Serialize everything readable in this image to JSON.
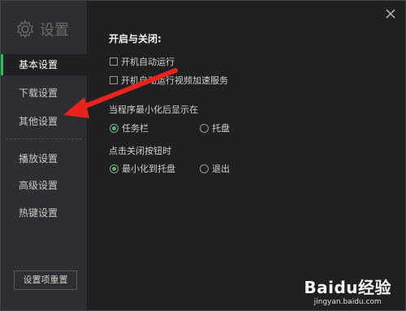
{
  "app": {
    "title": "设置"
  },
  "sidebar": {
    "items": [
      {
        "label": "基本设置",
        "active": true
      },
      {
        "label": "下载设置",
        "active": false
      },
      {
        "label": "其他设置",
        "active": false
      },
      {
        "label": "播放设置",
        "active": false
      },
      {
        "label": "高级设置",
        "active": false
      },
      {
        "label": "热键设置",
        "active": false
      }
    ],
    "reset_label": "设置项重置"
  },
  "main": {
    "section_title": "开启与关闭:",
    "options": [
      {
        "label": "开机自动运行",
        "checked": false
      },
      {
        "label": "开机自动运行视频加速服务",
        "checked": false
      }
    ],
    "minimize_group": {
      "label": "当程序最小化后显示在",
      "options": [
        {
          "label": "任务栏",
          "checked": true
        },
        {
          "label": "托盘",
          "checked": false
        }
      ]
    },
    "close_group": {
      "label": "点击关闭按钮时",
      "options": [
        {
          "label": "最小化到托盘",
          "checked": true
        },
        {
          "label": "退出",
          "checked": false
        }
      ]
    }
  },
  "watermark": {
    "brand": "Baidu经验",
    "url": "jingyan.baidu.com"
  },
  "colors": {
    "accent": "#2dbd5f",
    "arrow": "#e8231c"
  }
}
